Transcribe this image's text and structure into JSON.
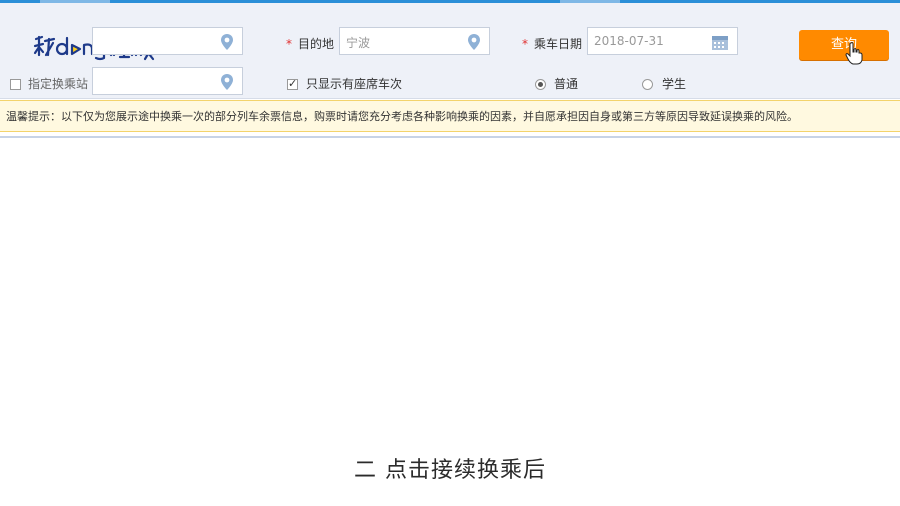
{
  "logo": {
    "text": "秒dòng视频"
  },
  "search": {
    "departure": {
      "value": ""
    },
    "destination": {
      "label": "目的地",
      "placeholder": "宁波"
    },
    "date": {
      "label": "乘车日期",
      "value": "2018-07-31"
    },
    "required_mark": "*",
    "transfer_station": {
      "label": "指定换乘站",
      "value": ""
    },
    "only_seats": {
      "label": "只显示有座席车次",
      "checked": true
    },
    "ticket_type": {
      "options": [
        "普通",
        "学生"
      ],
      "selected": "普通"
    },
    "query_label": "查询"
  },
  "tip": {
    "text": "温馨提示：以下仅为您展示途中换乘一次的部分列车余票信息，购票时请您充分考虑各种影响换乘的因素，并自愿承担因自身或第三方等原因导致延误换乘的风险。"
  },
  "subtitle": {
    "text": "二 点击接续换乘后"
  },
  "colors": {
    "accent": "#ff8a00",
    "brand_blue": "#2b8fd8",
    "tip_bg": "#fff9e0"
  }
}
